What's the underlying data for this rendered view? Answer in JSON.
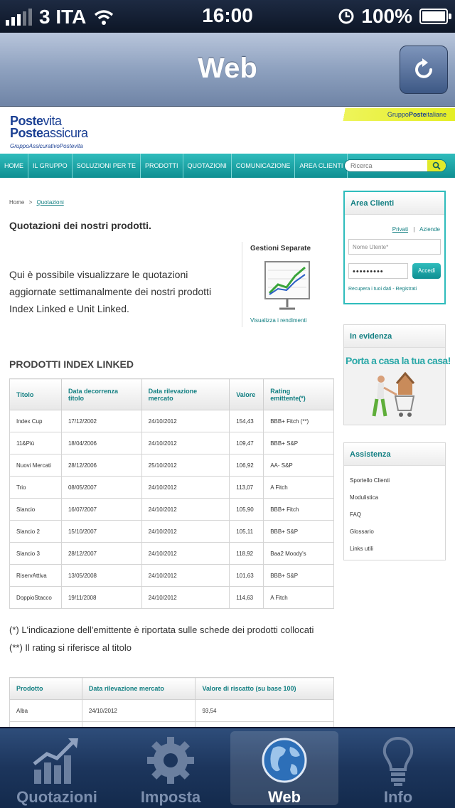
{
  "status_bar": {
    "carrier": "3 ITA",
    "time": "16:00",
    "battery": "100%"
  },
  "nav_bar": {
    "title": "Web"
  },
  "web": {
    "logo": {
      "line1_bold": "Poste",
      "line1_rest": "vita",
      "line2_bold": "Poste",
      "line2_rest": "assicura",
      "line3": "GruppoAssicurativoPostevita"
    },
    "gruppo": {
      "prefix": "Gruppo",
      "bold": "Poste",
      "suffix": "italiane"
    },
    "menu": [
      "HOME",
      "IL GRUPPO",
      "SOLUZIONI PER TE",
      "PRODOTTI",
      "QUOTAZIONI",
      "COMUNICAZIONE",
      "AREA CLIENTI"
    ],
    "search_placeholder": "Ricerca",
    "breadcrumb": {
      "home": "Home",
      "sep": ">",
      "current": "Quotazioni"
    },
    "page_title": "Quotazioni dei nostri prodotti.",
    "intro": "Qui è possibile visualizzare le quotazioni aggiornate settimanalmente dei nostri prodotti Index Linked e Unit Linked.",
    "gestioni": {
      "title": "Gestioni Separate",
      "link": "Visualizza i rendimenti"
    },
    "index_linked": {
      "title": "PRODOTTI INDEX LINKED",
      "headers": [
        "Titolo",
        "Data decorrenza titolo",
        "Data rilevazione mercato",
        "Valore",
        "Rating emittente(*)"
      ],
      "rows": [
        [
          "Index Cup",
          "17/12/2002",
          "24/10/2012",
          "154,43",
          "BBB+ Fitch (**)"
        ],
        [
          "11&Più",
          "18/04/2006",
          "24/10/2012",
          "109,47",
          "BBB+ S&P"
        ],
        [
          "Nuovi Mercati",
          "28/12/2006",
          "25/10/2012",
          "106,92",
          "AA- S&P"
        ],
        [
          "Trio",
          "08/05/2007",
          "24/10/2012",
          "113,07",
          "A Fitch"
        ],
        [
          "Slancio",
          "16/07/2007",
          "24/10/2012",
          "105,90",
          "BBB+ Fitch"
        ],
        [
          "Slancio 2",
          "15/10/2007",
          "24/10/2012",
          "105,11",
          "BBB+ S&P"
        ],
        [
          "Slancio 3",
          "28/12/2007",
          "24/10/2012",
          "118,92",
          "Baa2 Moody's"
        ],
        [
          "RiservAttiva",
          "13/05/2008",
          "24/10/2012",
          "101,63",
          "BBB+ S&P"
        ],
        [
          "DoppioStacco",
          "19/11/2008",
          "24/10/2012",
          "114,63",
          "A Fitch"
        ]
      ]
    },
    "notes": [
      "(*) L'indicazione dell'emittente è riportata sulle schede dei prodotti collocati",
      "(**) Il rating si riferisce al titolo"
    ],
    "riscatto": {
      "headers": [
        "Prodotto",
        "Data rilevazione mercato",
        "Valore di riscatto (su base 100)"
      ],
      "rows": [
        [
          "Alba",
          "24/10/2012",
          "93,54"
        ]
      ]
    },
    "area_clienti": {
      "title": "Area Clienti",
      "privati": "Privati",
      "divider": "|",
      "aziende": "Aziende",
      "username_placeholder": "Nome Utente*",
      "password_value": "•••••••••",
      "login_button": "Accedi",
      "recover": "Recupera i tuoi dati - Registrati"
    },
    "in_evidenza": {
      "title": "In evidenza",
      "banner_text": "Porta a casa la tua casa!"
    },
    "assistenza": {
      "title": "Assistenza",
      "items": [
        "Sportello Clienti",
        "Modulistica",
        "FAQ",
        "Glossario",
        "Links utili"
      ]
    }
  },
  "tab_bar": {
    "tabs": [
      {
        "label": "Quotazioni",
        "icon": "chart-icon"
      },
      {
        "label": "Imposta",
        "icon": "gear-icon"
      },
      {
        "label": "Web",
        "icon": "globe-icon"
      },
      {
        "label": "Info",
        "icon": "lightbulb-icon"
      }
    ],
    "active": "Web"
  },
  "colors": {
    "teal": "#1fa6a8",
    "nav_blue": "#8ea1bf",
    "tabbar_blue": "#1c355c",
    "poste_blue": "#1a3f93",
    "gruppo_yellow": "#e4ee24"
  }
}
